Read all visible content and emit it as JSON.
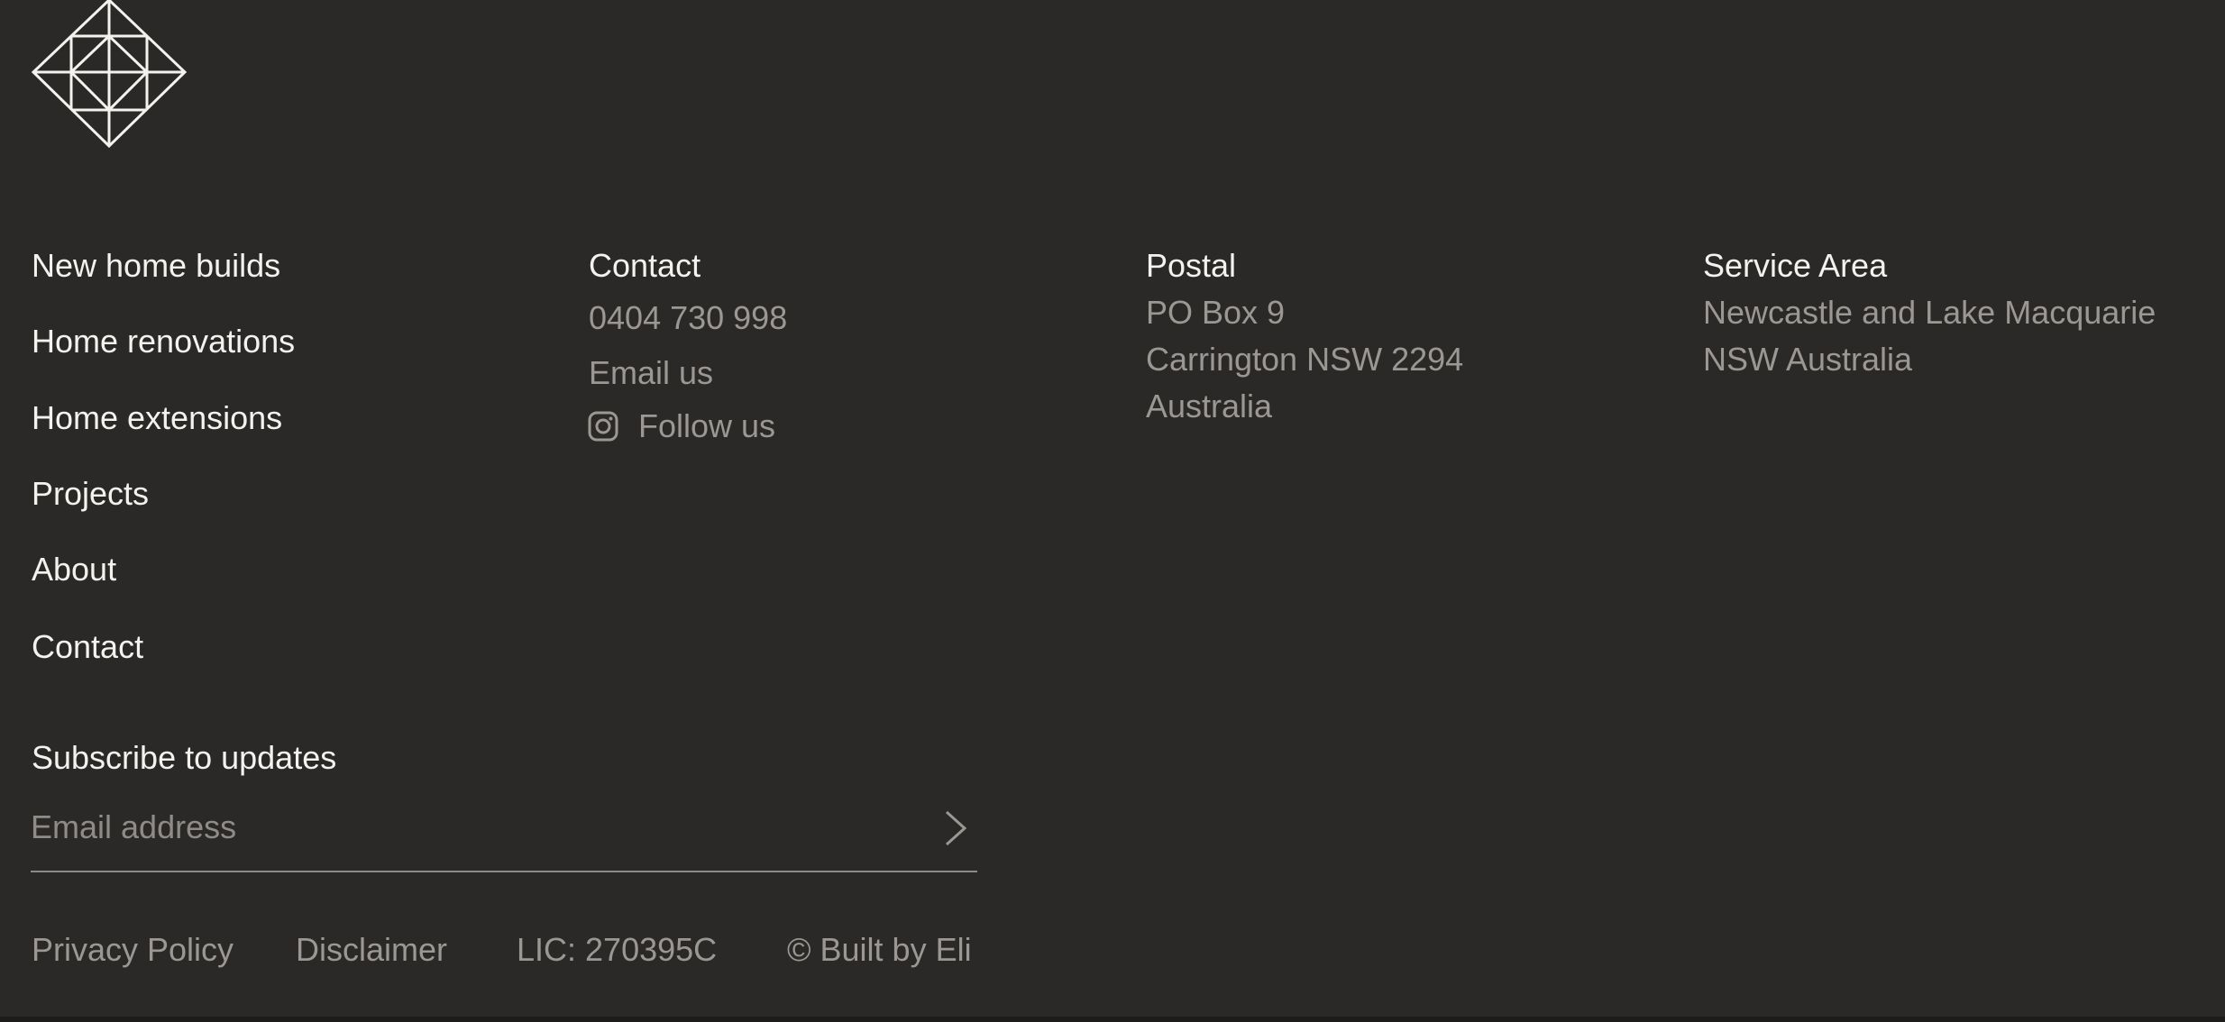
{
  "logo": {
    "icon": "geometric-diamond-logo"
  },
  "nav": {
    "items": [
      {
        "label": "New home builds"
      },
      {
        "label": "Home renovations"
      },
      {
        "label": "Home extensions"
      },
      {
        "label": "Projects"
      },
      {
        "label": "About"
      },
      {
        "label": "Contact"
      }
    ]
  },
  "contact": {
    "heading": "Contact",
    "phone": "0404 730 998",
    "email": "Email us",
    "follow": "Follow us",
    "follow_icon": "instagram-icon"
  },
  "postal": {
    "heading": "Postal",
    "lines": [
      "PO Box 9",
      "Carrington NSW 2294",
      "Australia"
    ]
  },
  "service_area": {
    "heading": "Service Area",
    "lines": [
      "Newcastle and Lake Macquarie",
      "NSW Australia"
    ]
  },
  "subscribe": {
    "title": "Subscribe to updates",
    "placeholder": "Email address",
    "value": "",
    "submit_icon": "chevron-right-icon"
  },
  "footer": {
    "privacy": "Privacy Policy",
    "disclaimer": "Disclaimer",
    "licence": "LIC: 270395C",
    "credit": "© Built by Eli"
  },
  "colors": {
    "background": "#2b2928",
    "primary_text": "#f4f2ee",
    "muted_text": "#9b9894"
  }
}
